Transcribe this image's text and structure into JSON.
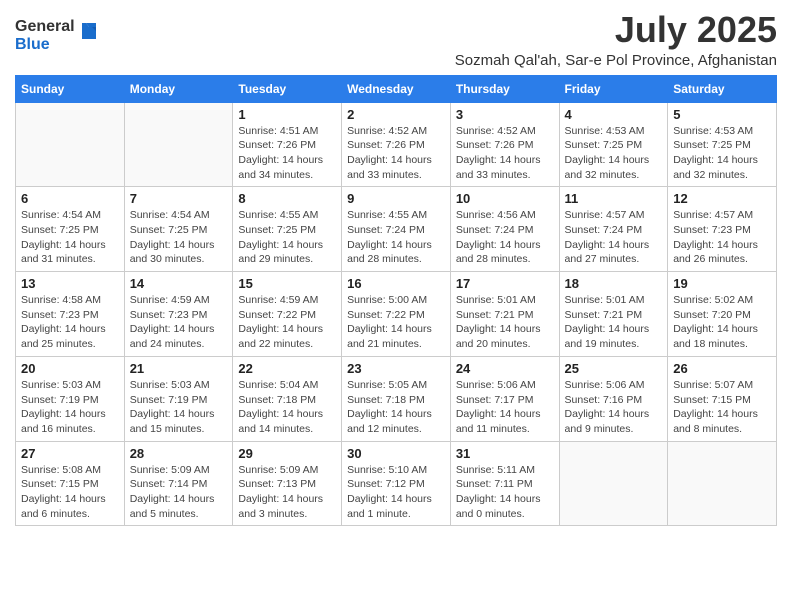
{
  "logo": {
    "general": "General",
    "blue": "Blue"
  },
  "title": "July 2025",
  "subtitle": "Sozmah Qal'ah, Sar-e Pol Province, Afghanistan",
  "days_of_week": [
    "Sunday",
    "Monday",
    "Tuesday",
    "Wednesday",
    "Thursday",
    "Friday",
    "Saturday"
  ],
  "weeks": [
    [
      {
        "day": "",
        "info": ""
      },
      {
        "day": "",
        "info": ""
      },
      {
        "day": "1",
        "sunrise": "4:51 AM",
        "sunset": "7:26 PM",
        "daylight": "14 hours and 34 minutes."
      },
      {
        "day": "2",
        "sunrise": "4:52 AM",
        "sunset": "7:26 PM",
        "daylight": "14 hours and 33 minutes."
      },
      {
        "day": "3",
        "sunrise": "4:52 AM",
        "sunset": "7:26 PM",
        "daylight": "14 hours and 33 minutes."
      },
      {
        "day": "4",
        "sunrise": "4:53 AM",
        "sunset": "7:25 PM",
        "daylight": "14 hours and 32 minutes."
      },
      {
        "day": "5",
        "sunrise": "4:53 AM",
        "sunset": "7:25 PM",
        "daylight": "14 hours and 32 minutes."
      }
    ],
    [
      {
        "day": "6",
        "sunrise": "4:54 AM",
        "sunset": "7:25 PM",
        "daylight": "14 hours and 31 minutes."
      },
      {
        "day": "7",
        "sunrise": "4:54 AM",
        "sunset": "7:25 PM",
        "daylight": "14 hours and 30 minutes."
      },
      {
        "day": "8",
        "sunrise": "4:55 AM",
        "sunset": "7:25 PM",
        "daylight": "14 hours and 29 minutes."
      },
      {
        "day": "9",
        "sunrise": "4:55 AM",
        "sunset": "7:24 PM",
        "daylight": "14 hours and 28 minutes."
      },
      {
        "day": "10",
        "sunrise": "4:56 AM",
        "sunset": "7:24 PM",
        "daylight": "14 hours and 28 minutes."
      },
      {
        "day": "11",
        "sunrise": "4:57 AM",
        "sunset": "7:24 PM",
        "daylight": "14 hours and 27 minutes."
      },
      {
        "day": "12",
        "sunrise": "4:57 AM",
        "sunset": "7:23 PM",
        "daylight": "14 hours and 26 minutes."
      }
    ],
    [
      {
        "day": "13",
        "sunrise": "4:58 AM",
        "sunset": "7:23 PM",
        "daylight": "14 hours and 25 minutes."
      },
      {
        "day": "14",
        "sunrise": "4:59 AM",
        "sunset": "7:23 PM",
        "daylight": "14 hours and 24 minutes."
      },
      {
        "day": "15",
        "sunrise": "4:59 AM",
        "sunset": "7:22 PM",
        "daylight": "14 hours and 22 minutes."
      },
      {
        "day": "16",
        "sunrise": "5:00 AM",
        "sunset": "7:22 PM",
        "daylight": "14 hours and 21 minutes."
      },
      {
        "day": "17",
        "sunrise": "5:01 AM",
        "sunset": "7:21 PM",
        "daylight": "14 hours and 20 minutes."
      },
      {
        "day": "18",
        "sunrise": "5:01 AM",
        "sunset": "7:21 PM",
        "daylight": "14 hours and 19 minutes."
      },
      {
        "day": "19",
        "sunrise": "5:02 AM",
        "sunset": "7:20 PM",
        "daylight": "14 hours and 18 minutes."
      }
    ],
    [
      {
        "day": "20",
        "sunrise": "5:03 AM",
        "sunset": "7:19 PM",
        "daylight": "14 hours and 16 minutes."
      },
      {
        "day": "21",
        "sunrise": "5:03 AM",
        "sunset": "7:19 PM",
        "daylight": "14 hours and 15 minutes."
      },
      {
        "day": "22",
        "sunrise": "5:04 AM",
        "sunset": "7:18 PM",
        "daylight": "14 hours and 14 minutes."
      },
      {
        "day": "23",
        "sunrise": "5:05 AM",
        "sunset": "7:18 PM",
        "daylight": "14 hours and 12 minutes."
      },
      {
        "day": "24",
        "sunrise": "5:06 AM",
        "sunset": "7:17 PM",
        "daylight": "14 hours and 11 minutes."
      },
      {
        "day": "25",
        "sunrise": "5:06 AM",
        "sunset": "7:16 PM",
        "daylight": "14 hours and 9 minutes."
      },
      {
        "day": "26",
        "sunrise": "5:07 AM",
        "sunset": "7:15 PM",
        "daylight": "14 hours and 8 minutes."
      }
    ],
    [
      {
        "day": "27",
        "sunrise": "5:08 AM",
        "sunset": "7:15 PM",
        "daylight": "14 hours and 6 minutes."
      },
      {
        "day": "28",
        "sunrise": "5:09 AM",
        "sunset": "7:14 PM",
        "daylight": "14 hours and 5 minutes."
      },
      {
        "day": "29",
        "sunrise": "5:09 AM",
        "sunset": "7:13 PM",
        "daylight": "14 hours and 3 minutes."
      },
      {
        "day": "30",
        "sunrise": "5:10 AM",
        "sunset": "7:12 PM",
        "daylight": "14 hours and 1 minute."
      },
      {
        "day": "31",
        "sunrise": "5:11 AM",
        "sunset": "7:11 PM",
        "daylight": "14 hours and 0 minutes."
      },
      {
        "day": "",
        "info": ""
      },
      {
        "day": "",
        "info": ""
      }
    ]
  ]
}
